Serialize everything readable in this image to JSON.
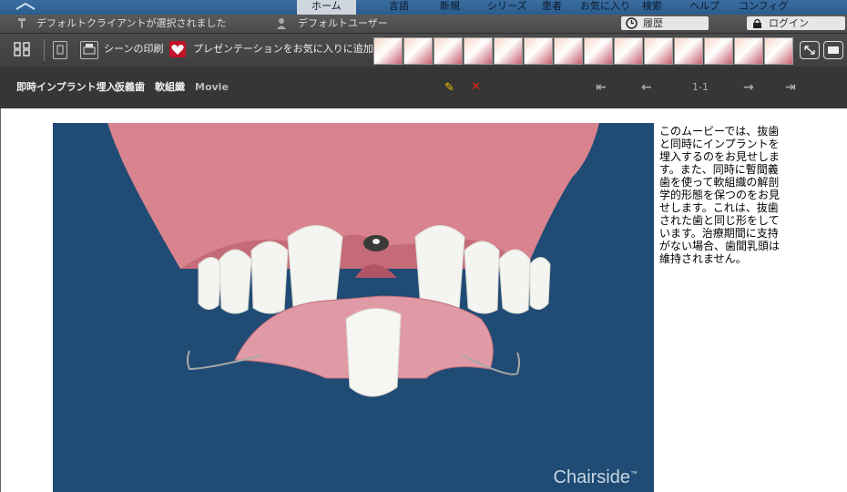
{
  "nav": {
    "items": [
      "ホーム",
      "言語",
      "新規",
      "シリーズ",
      "患者",
      "お気に入り",
      "検索",
      "ヘルプ",
      "コンフィグ"
    ]
  },
  "status": {
    "client_text": "デフォルトクライアントが選択されました",
    "user_text": "デフォルトユーザー",
    "history_label": "履歴",
    "login_label": "ログイン"
  },
  "toolbar": {
    "print_label": "シーンの印刷",
    "favorite_label": "プレゼンテーションをお気に入りに追加"
  },
  "title": {
    "parts": [
      "即時インプラント埋入",
      "仮義歯",
      "軟組織",
      "Movie"
    ],
    "page_indicator": "1-1"
  },
  "video": {
    "brand": "Chairside",
    "brand_mark": "™"
  },
  "description": "このムービーでは、抜歯と同時にインプラントを埋入するのをお見せします。また、同時に暫間義歯を使って軟組織の解剖学的形態を保つのをお見せします。これは、抜歯された歯と同じ形をしています。治療期間に支持がない場合、歯間乳頭は維持されません。",
  "colors": {
    "video_bg": "#1f4b74",
    "gum": "#d8838e",
    "delete": "#e02a1a",
    "edit": "#f2c200"
  }
}
